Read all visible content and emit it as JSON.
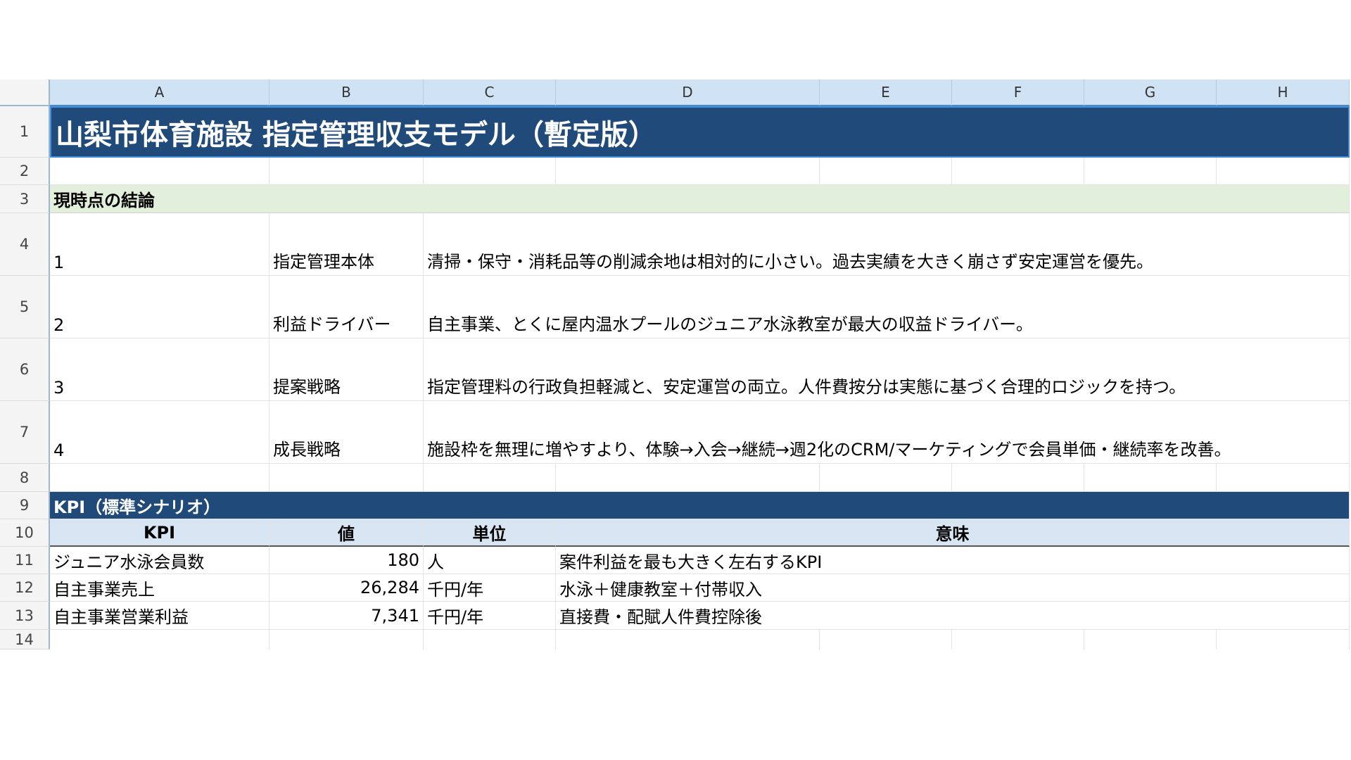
{
  "columns": [
    "A",
    "B",
    "C",
    "D",
    "E",
    "F",
    "G",
    "H"
  ],
  "rows": [
    "1",
    "2",
    "3",
    "4",
    "5",
    "6",
    "7",
    "8",
    "9",
    "10",
    "11",
    "12",
    "13",
    "14"
  ],
  "title": "山梨市体育施設 指定管理収支モデル（暫定版）",
  "conclusion": {
    "heading": "現時点の結論",
    "items": [
      {
        "num": "1",
        "label": "指定管理本体",
        "text": "清掃・保守・消耗品等の削減余地は相対的に小さい。過去実績を大きく崩さず安定運営を優先。"
      },
      {
        "num": "2",
        "label": "利益ドライバー",
        "text": "自主事業、とくに屋内温水プールのジュニア水泳教室が最大の収益ドライバー。"
      },
      {
        "num": "3",
        "label": "提案戦略",
        "text": "指定管理料の行政負担軽減と、安定運営の両立。人件費按分は実態に基づく合理的ロジックを持つ。"
      },
      {
        "num": "4",
        "label": "成長戦略",
        "text": "施設枠を無理に増やすより、体験→入会→継続→週2化のCRM/マーケティングで会員単価・継続率を改善。"
      }
    ]
  },
  "kpi": {
    "heading": "KPI（標準シナリオ）",
    "headers": {
      "kpi": "KPI",
      "value": "値",
      "unit": "単位",
      "meaning": "意味"
    },
    "rows": [
      {
        "name": "ジュニア水泳会員数",
        "value": "180",
        "unit": "人",
        "meaning": "案件利益を最も大きく左右するKPI"
      },
      {
        "name": "自主事業売上",
        "value": "26,284",
        "unit": "千円/年",
        "meaning": "水泳＋健康教室＋付帯収入"
      },
      {
        "name": "自主事業営業利益",
        "value": "7,341",
        "unit": "千円/年",
        "meaning": "直接費・配賦人件費控除後"
      }
    ]
  }
}
